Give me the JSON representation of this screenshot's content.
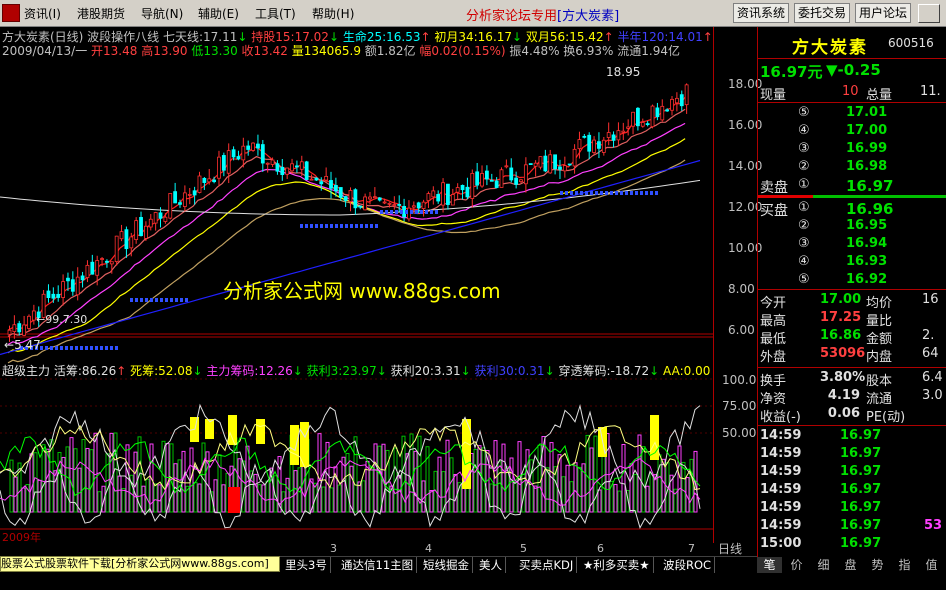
{
  "menu": {
    "items": [
      "资讯(I)",
      "港股期货",
      "导航(N)",
      "辅助(E)",
      "工具(T)",
      "帮助(H)"
    ],
    "brand": "分析家论坛专用",
    "brand_tag": "[方大炭素]",
    "buttons": [
      "资讯系统",
      "委托交易",
      "用户论坛"
    ]
  },
  "header": {
    "line1": {
      "title": "方大炭素(日线) 波段操作八线 七天线:17.11",
      "items": [
        {
          "text": "↓",
          "color": "#00e000"
        },
        {
          "text": " 持股15:17.02",
          "color": "#ff4040"
        },
        {
          "text": "↓",
          "color": "#00e000"
        },
        {
          "text": " 生命25:16.53",
          "color": "#00ffff"
        },
        {
          "text": "↑",
          "color": "#ff4040"
        },
        {
          "text": " 初月34:16.17",
          "color": "#ffff00"
        },
        {
          "text": "↓",
          "color": "#00e000"
        },
        {
          "text": " 双月56:15.42",
          "color": "#ffff00"
        },
        {
          "text": "↑",
          "color": "#ff4040"
        },
        {
          "text": " 半年120:14.01",
          "color": "#4040ff"
        },
        {
          "text": "↑",
          "color": "#ff4040"
        }
      ]
    },
    "line2": [
      {
        "text": "2009/04/13/一 ",
        "color": "#c0c0c0"
      },
      {
        "text": "开13.48 ",
        "color": "#ff4040"
      },
      {
        "text": "高13.90 ",
        "color": "#ff4040"
      },
      {
        "text": "低13.30 ",
        "color": "#00e000"
      },
      {
        "text": "收13.42 ",
        "color": "#ff4040"
      },
      {
        "text": "量134065.9 ",
        "color": "#ffff00"
      },
      {
        "text": "额1.82亿 ",
        "color": "#c0c0c0"
      },
      {
        "text": "幅0.02(0.15%) ",
        "color": "#ff4040"
      },
      {
        "text": "振4.48% 换6.93% 流通1.94亿",
        "color": "#c0c0c0"
      }
    ]
  },
  "price_axis": [
    "18.00",
    "16.00",
    "14.00",
    "12.00",
    "10.00",
    "8.00",
    "6.00"
  ],
  "annotations": {
    "high": "18.95",
    "low": "5.47",
    "mid": "99.7.30",
    "watermark": "分析家公式网 www.88gs.com"
  },
  "indicator": {
    "items": [
      {
        "text": "超级主力 ",
        "color": "#e0e0e0"
      },
      {
        "text": "活筹:86.26",
        "color": "#e0e0e0"
      },
      {
        "text": "↑",
        "color": "#ff4040"
      },
      {
        "text": " 死筹:52.08",
        "color": "#ffff00"
      },
      {
        "text": "↓",
        "color": "#00e000"
      },
      {
        "text": "  主力筹码:12.26",
        "color": "#ff40ff"
      },
      {
        "text": "↓",
        "color": "#00e000"
      },
      {
        "text": "  获利3:23.97",
        "color": "#00e000"
      },
      {
        "text": "↓",
        "color": "#00e000"
      },
      {
        "text": "  获利20:3.31",
        "color": "#e0e0e0"
      },
      {
        "text": "↓",
        "color": "#00e000"
      },
      {
        "text": "  获利30:0.31",
        "color": "#4040ff"
      },
      {
        "text": "↓",
        "color": "#00e000"
      },
      {
        "text": "  穿透筹码:-18.72",
        "color": "#e0e0e0"
      },
      {
        "text": "↓",
        "color": "#00e000"
      },
      {
        "text": "  AA:0.00",
        "color": "#ffff00"
      }
    ],
    "axis": [
      "100.0",
      "75.00",
      "50.00"
    ]
  },
  "time_axis": {
    "start": "2009年",
    "ticks": [
      "3",
      "4",
      "5",
      "6",
      "7"
    ],
    "period": "日线"
  },
  "bottom_tabs": [
    "股票公式股票软件下载[分析家公式网www.88gs.com]",
    "里头3号",
    "通达信11主图",
    "短线掘金",
    "美人",
    "买卖点KDJ",
    "★利多买卖★",
    "波段ROC"
  ],
  "quote": {
    "name": "方大炭素",
    "code": "600516",
    "price": "16.97元",
    "change": "▼-0.25",
    "current_vol_label": "现量",
    "current_vol": "10",
    "total_vol_label": "总量",
    "total_vol": "11.",
    "sell_label": "卖盘",
    "buy_label": "买盘",
    "sells": [
      {
        "no": "⑤",
        "price": "17.01"
      },
      {
        "no": "④",
        "price": "17.00"
      },
      {
        "no": "③",
        "price": "16.99"
      },
      {
        "no": "②",
        "price": "16.98"
      },
      {
        "no": "①",
        "price": "16.97"
      }
    ],
    "buys": [
      {
        "no": "①",
        "price": "16.96"
      },
      {
        "no": "②",
        "price": "16.95"
      },
      {
        "no": "③",
        "price": "16.94"
      },
      {
        "no": "④",
        "price": "16.93"
      },
      {
        "no": "⑤",
        "price": "16.92"
      }
    ],
    "stats": [
      {
        "l1": "今开",
        "v1": "17.00",
        "c1": "#00e000",
        "l2": "均价",
        "v2": "16"
      },
      {
        "l1": "最高",
        "v1": "17.25",
        "c1": "#ff4040",
        "l2": "量比",
        "v2": ""
      },
      {
        "l1": "最低",
        "v1": "16.86",
        "c1": "#00e000",
        "l2": "金额",
        "v2": "2."
      },
      {
        "l1": "外盘",
        "v1": "53096",
        "c1": "#ff4040",
        "l2": "内盘",
        "v2": "64"
      }
    ],
    "stats2": [
      {
        "l1": "换手",
        "v1": "3.80%",
        "l2": "股本",
        "v2": "6.4"
      },
      {
        "l1": "净资",
        "v1": "4.19",
        "l2": "流通",
        "v2": "3.0"
      },
      {
        "l1": "收益(-)",
        "v1": "0.06",
        "l2": "PE(动)",
        "v2": ""
      }
    ],
    "ticks": [
      {
        "time": "14:59",
        "price": "16.97",
        "vol": "",
        "vcolor": "#ffff00"
      },
      {
        "time": "14:59",
        "price": "16.97",
        "vol": "",
        "vcolor": "#ffff00"
      },
      {
        "time": "14:59",
        "price": "16.97",
        "vol": "",
        "vcolor": "#ffff00"
      },
      {
        "time": "14:59",
        "price": "16.97",
        "vol": "",
        "vcolor": "#ffff00"
      },
      {
        "time": "14:59",
        "price": "16.97",
        "vol": "",
        "vcolor": "#ffff00"
      },
      {
        "time": "14:59",
        "price": "16.97",
        "vol": "53",
        "vcolor": "#ff40ff"
      },
      {
        "time": "15:00",
        "price": "16.97",
        "vol": "",
        "vcolor": "#ffff00"
      }
    ],
    "panel_tabs": [
      "笔",
      "价",
      "细",
      "盘",
      "势",
      "指",
      "值"
    ]
  },
  "colors": {
    "up": "#ff4040",
    "down": "#00e000",
    "frame": "#b00000",
    "axis": "#c0c0c0"
  }
}
